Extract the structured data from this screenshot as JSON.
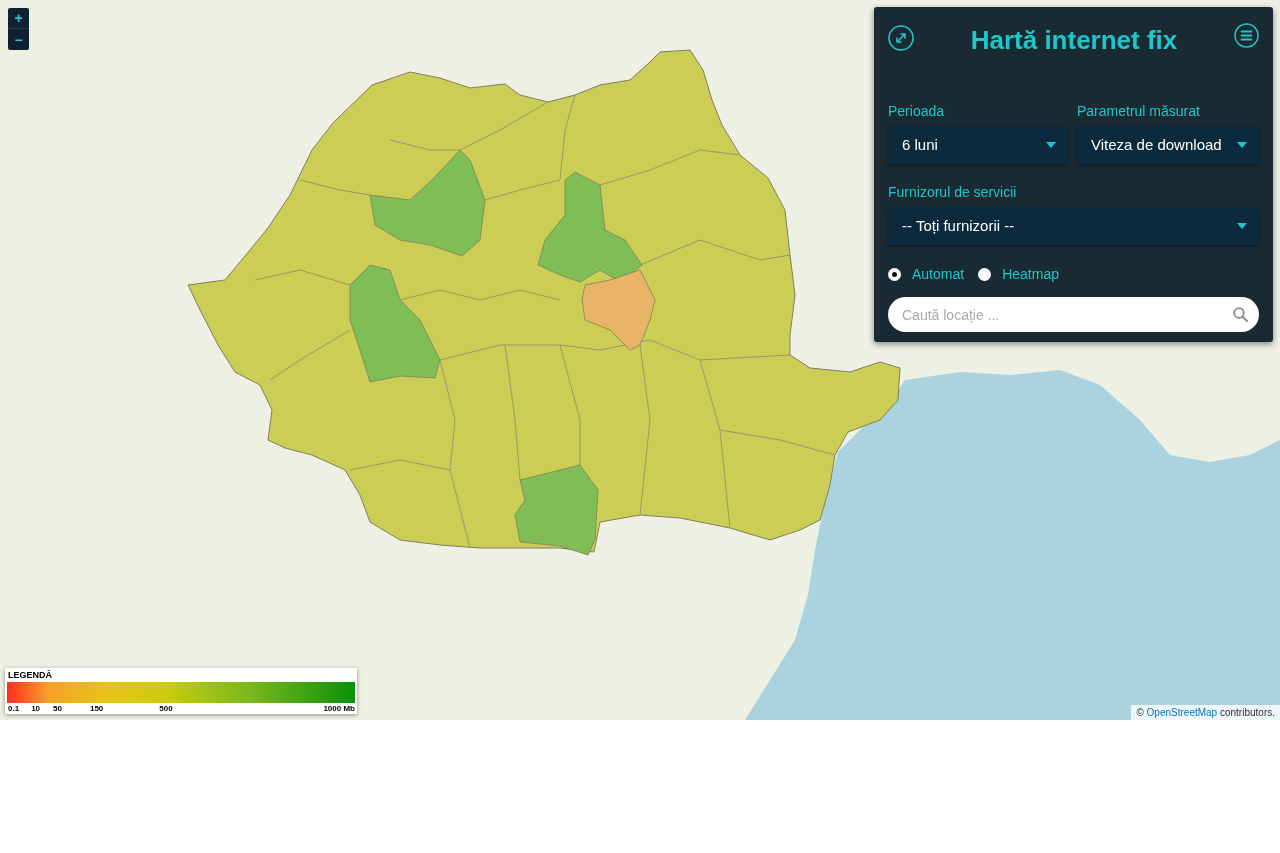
{
  "map": {
    "zoom_controls": [
      "+",
      "−"
    ],
    "legend": {
      "title": "LEGENDĂ",
      "ticks": [
        "0.1",
        "10",
        "50",
        "150",
        "500",
        "1000 Mb"
      ]
    },
    "attribution": {
      "symbol": "©",
      "link": "OpenStreetMap",
      "text": "contributors."
    }
  },
  "panel": {
    "title": "Hartă internet fix",
    "filters": [
      {
        "label": "Perioada",
        "value": "6 luni"
      },
      {
        "label": "Parametrul măsurat",
        "value": "Viteza de download"
      },
      {
        "label": "Furnizorul de servicii",
        "value": "-- Toți furnizorii --"
      }
    ],
    "modes": [
      {
        "label": "Automat",
        "selected": true
      },
      {
        "label": "Heatmap",
        "selected": false
      }
    ],
    "search": {
      "placeholder": "Caută locație ..."
    }
  }
}
